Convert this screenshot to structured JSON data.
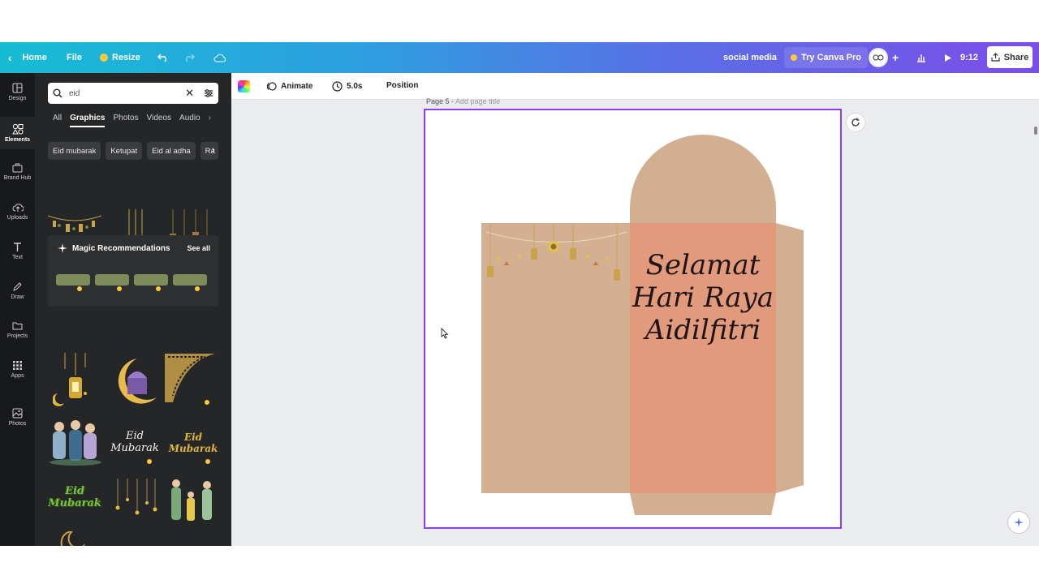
{
  "topbar": {
    "home": "Home",
    "file": "File",
    "resize": "Resize",
    "doc_title": "social media",
    "try_pro": "Try Canva Pro",
    "timer": "9:12",
    "share": "Share"
  },
  "rail": {
    "design": "Design",
    "elements": "Elements",
    "brand_hub": "Brand Hub",
    "uploads": "Uploads",
    "text": "Text",
    "draw": "Draw",
    "projects": "Projects",
    "apps": "Apps",
    "photos": "Photos"
  },
  "panel": {
    "search_value": "eid",
    "tabs": [
      "All",
      "Graphics",
      "Photos",
      "Videos",
      "Audio"
    ],
    "chips": [
      "Eid mubarak",
      "Ketupat",
      "Eid al adha",
      "Ra"
    ],
    "magic_title": "Magic Recommendations",
    "see_all": "See all",
    "eid_mubarak_script": "Eid Mubarak",
    "eid_mubarak_green": "Eid Mubarak"
  },
  "toolbar": {
    "animate": "Animate",
    "duration": "5.0s",
    "position": "Position"
  },
  "page": {
    "label": "Page 5 -",
    "title_placeholder": "Add page title",
    "greeting_line1": "Selamat",
    "greeting_line2": "Hari Raya",
    "greeting_line3": "Aidilfitri"
  },
  "colors": {
    "accent": "#8b3dff",
    "envelope_tan": "#d2af91",
    "envelope_front": "#e29a7c",
    "panel_bg": "#252627",
    "rail_bg": "#18191b"
  }
}
